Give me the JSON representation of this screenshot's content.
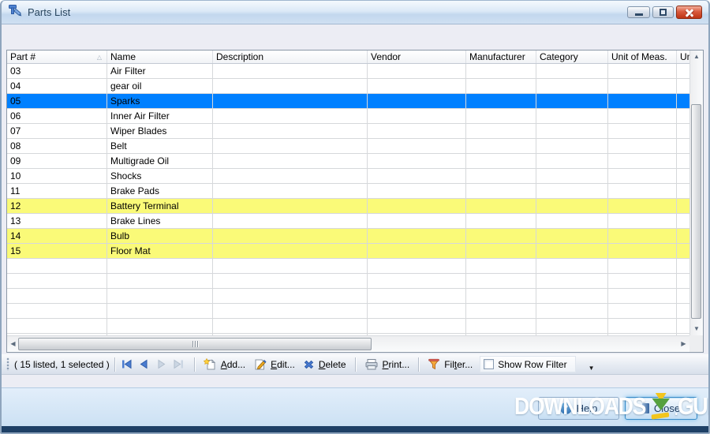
{
  "window": {
    "title": "Parts List"
  },
  "grid": {
    "columns": [
      {
        "label": "Part #",
        "sorted": true
      },
      {
        "label": "Name"
      },
      {
        "label": "Description"
      },
      {
        "label": "Vendor"
      },
      {
        "label": "Manufacturer"
      },
      {
        "label": "Category"
      },
      {
        "label": "Unit of Meas."
      },
      {
        "label": "Unit"
      }
    ],
    "rows": [
      {
        "part": "03",
        "name": "Air Filter",
        "state": "normal"
      },
      {
        "part": "04",
        "name": "gear oil",
        "state": "normal"
      },
      {
        "part": "05",
        "name": "Sparks",
        "state": "selected"
      },
      {
        "part": "06",
        "name": "Inner Air Filter",
        "state": "normal"
      },
      {
        "part": "07",
        "name": "Wiper Blades",
        "state": "normal"
      },
      {
        "part": "08",
        "name": "Belt",
        "state": "normal"
      },
      {
        "part": "09",
        "name": "Multigrade Oil",
        "state": "normal"
      },
      {
        "part": "10",
        "name": "Shocks",
        "state": "normal"
      },
      {
        "part": "11",
        "name": "Brake Pads",
        "state": "normal"
      },
      {
        "part": "12",
        "name": "Battery Terminal",
        "state": "highlighted"
      },
      {
        "part": "13",
        "name": "Brake Lines",
        "state": "normal"
      },
      {
        "part": "14",
        "name": "Bulb",
        "state": "highlighted"
      },
      {
        "part": "15",
        "name": "Floor Mat",
        "state": "highlighted"
      }
    ],
    "empty_rows": 6
  },
  "toolbar": {
    "status": "( 15 listed, 1 selected )",
    "buttons": {
      "add": {
        "label": "Add...",
        "accel": 0
      },
      "edit": {
        "label": "Edit...",
        "accel": 0
      },
      "delete": {
        "label": "Delete",
        "accel": 0
      },
      "print": {
        "label": "Print...",
        "accel": 0
      },
      "filter": {
        "label": "Filter...",
        "accel": 3
      }
    },
    "show_row_filter": {
      "label": "Show Row Filter",
      "checked": false
    }
  },
  "footer": {
    "help": "Help",
    "close": "Close"
  },
  "watermark": {
    "left": "DOWNLOADS",
    "dot": ".",
    "right": "GURU"
  },
  "colors": {
    "selected_row": "#0080FF",
    "highlighted_row": "#FAFA78",
    "titlebar_text": "#29465F",
    "close_red": "#BE3415",
    "footer_bg": "#E2EEFA",
    "watermark_green": "#55A13F",
    "watermark_yellow": "#F2C51D"
  }
}
